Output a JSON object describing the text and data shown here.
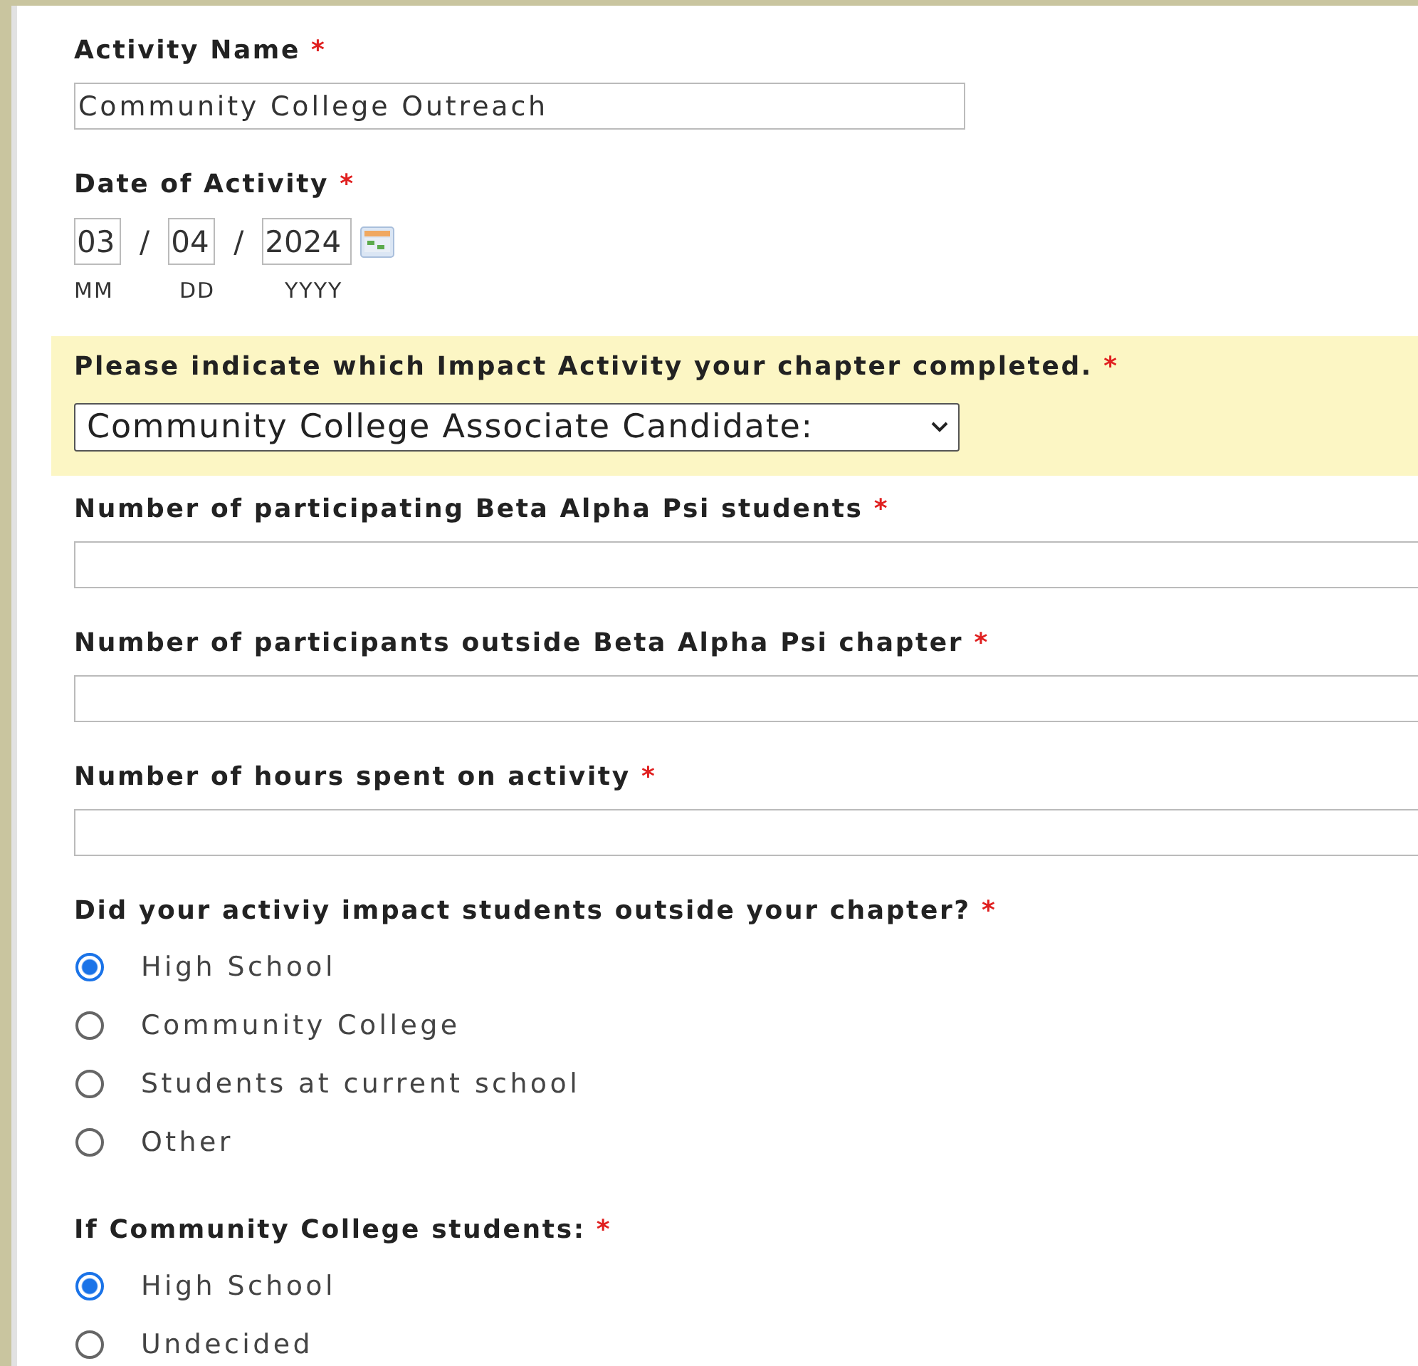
{
  "fields": [
    {
      "kind": "text",
      "label": "Activity Name",
      "mark": "*",
      "value": "Community College Outreach",
      "wide": false
    },
    {
      "kind": "date",
      "label": "Date of Activity",
      "mark": "*",
      "parts": [
        {
          "value": "03",
          "caption": "MM"
        },
        {
          "value": "04",
          "caption": "DD"
        },
        {
          "value": "2024",
          "caption": "YYYY"
        }
      ],
      "separator": "/"
    },
    {
      "kind": "select",
      "label": "Please indicate which Impact Activity your chapter completed.",
      "mark": "*",
      "value": "Community College Associate Candidate:",
      "highlighted": true
    },
    {
      "kind": "text",
      "label": "Number of participating Beta Alpha Psi students",
      "mark": "*",
      "wide": true
    },
    {
      "kind": "text",
      "label": "Number of participants outside Beta Alpha Psi chapter",
      "mark": "*",
      "wide": true
    },
    {
      "kind": "text",
      "label": "Number of hours spent on activity",
      "mark": "*",
      "wide": true
    },
    {
      "kind": "radio",
      "label": "Did your activiy impact students outside your chapter?",
      "mark": "*",
      "options": [
        {
          "label": "High School",
          "selected": true
        },
        {
          "label": "Community College",
          "selected": false
        },
        {
          "label": "Students at current school",
          "selected": false
        },
        {
          "label": "Other",
          "selected": false
        }
      ]
    },
    {
      "kind": "radio",
      "label": "If Community College students:",
      "mark": "*",
      "options": [
        {
          "label": "High School",
          "selected": true
        },
        {
          "label": "Undecided",
          "selected": false
        }
      ]
    }
  ]
}
